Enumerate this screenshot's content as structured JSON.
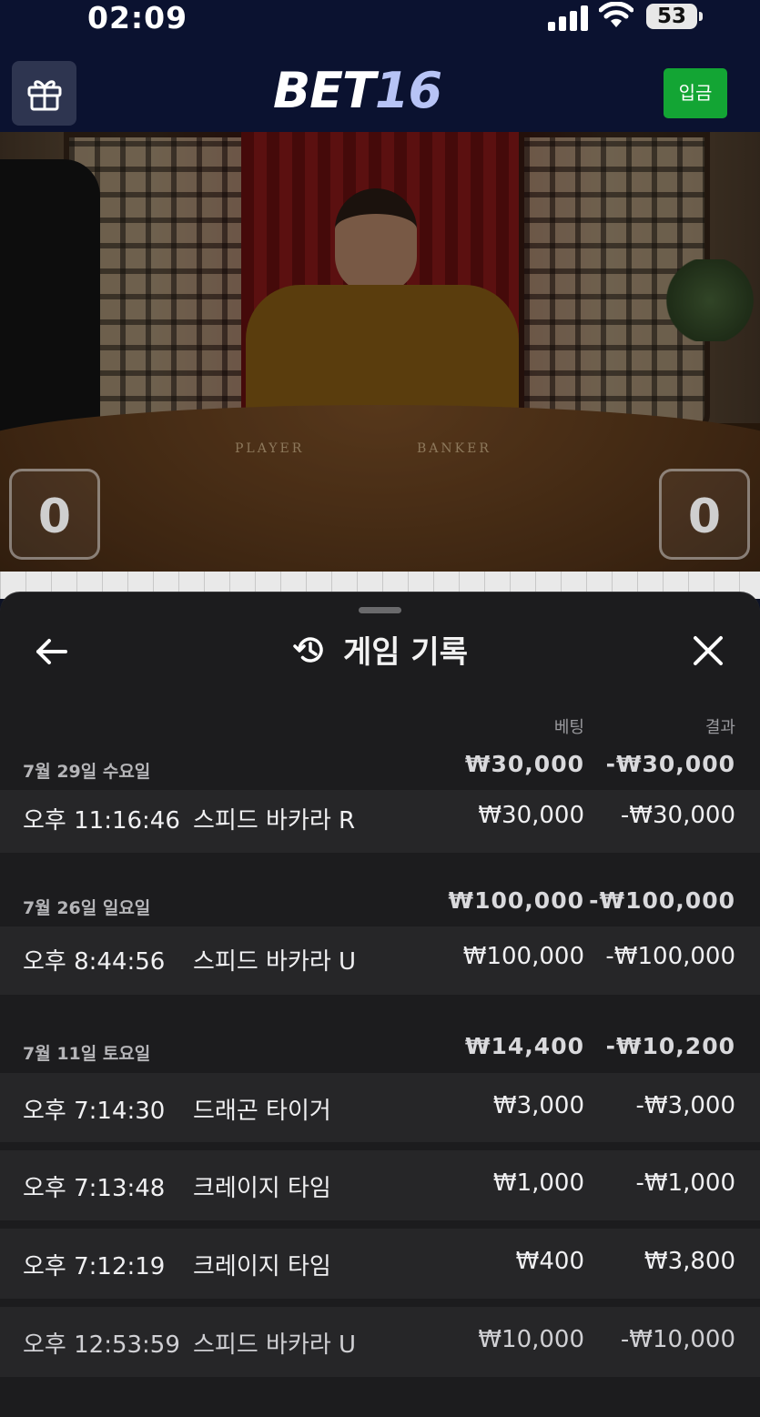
{
  "status_bar": {
    "time": "02:09",
    "battery": "53"
  },
  "header": {
    "logo_main": "BET",
    "logo_number": "16",
    "deposit_label": "입금",
    "accent_color": "#13a534"
  },
  "video": {
    "player_label": "PLAYER",
    "banker_label": "BANKER",
    "player_score": "0",
    "banker_score": "0"
  },
  "sheet": {
    "title": "게임 기록",
    "columns": {
      "bet": "베팅",
      "result": "결과"
    },
    "days": [
      {
        "date": "7월 29일 수요일",
        "bet_total": "₩30,000",
        "result_total": "-₩30,000",
        "rows": [
          {
            "time": "오후 11:16:46",
            "game": "스피드 바카라 R",
            "bet": "₩30,000",
            "result": "-₩30,000"
          }
        ]
      },
      {
        "date": "7월 26일 일요일",
        "bet_total": "₩100,000",
        "result_total": "-₩100,000",
        "rows": [
          {
            "time": "오후 8:44:56",
            "game": "스피드 바카라 U",
            "bet": "₩100,000",
            "result": "-₩100,000"
          }
        ]
      },
      {
        "date": "7월 11일 토요일",
        "bet_total": "₩14,400",
        "result_total": "-₩10,200",
        "rows": [
          {
            "time": "오후 7:14:30",
            "game": "드래곤 타이거",
            "bet": "₩3,000",
            "result": "-₩3,000"
          },
          {
            "time": "오후 7:13:48",
            "game": "크레이지 타임",
            "bet": "₩1,000",
            "result": "-₩1,000"
          },
          {
            "time": "오후 7:12:19",
            "game": "크레이지 타임",
            "bet": "₩400",
            "result": "₩3,800"
          },
          {
            "time": "오후 12:53:59",
            "game": "스피드 바카라 U",
            "bet": "₩10,000",
            "result": "-₩10,000"
          }
        ]
      }
    ]
  }
}
